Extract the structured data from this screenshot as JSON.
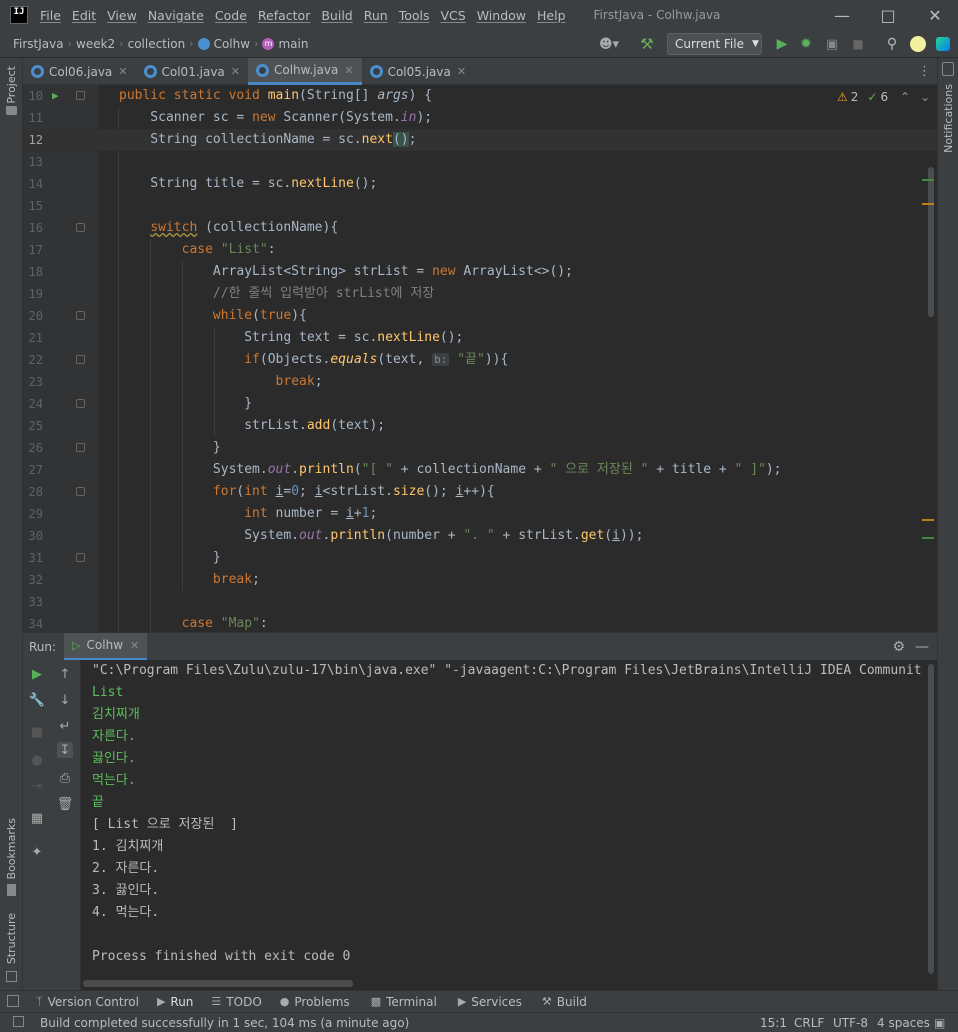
{
  "titlebar": {
    "logo": "IJ",
    "menu": [
      "File",
      "Edit",
      "View",
      "Navigate",
      "Code",
      "Refactor",
      "Build",
      "Run",
      "Tools",
      "VCS",
      "Window",
      "Help"
    ],
    "title": "FirstJava - Colhw.java"
  },
  "navbar": {
    "breadcrumbs": [
      "FirstJava",
      "week2",
      "collection",
      "Colhw",
      "main"
    ],
    "run_config": "Current File"
  },
  "tabs": [
    {
      "label": "Col06.java",
      "active": false
    },
    {
      "label": "Col01.java",
      "active": false
    },
    {
      "label": "Colhw.java",
      "active": true
    },
    {
      "label": "Col05.java",
      "active": false
    }
  ],
  "left_strip": {
    "project": "Project",
    "bookmarks": "Bookmarks",
    "structure": "Structure"
  },
  "right_strip": {
    "notifications": "Notifications"
  },
  "inspections": {
    "warnings": "2",
    "weak": "6"
  },
  "editor": {
    "line_numbers": [
      "10",
      "11",
      "12",
      "13",
      "14",
      "15",
      "16",
      "17",
      "18",
      "19",
      "20",
      "21",
      "22",
      "23",
      "24",
      "25",
      "26",
      "27",
      "28",
      "29",
      "30",
      "31",
      "32",
      "33",
      "34"
    ],
    "current_line": "12",
    "param_hint": "b:"
  },
  "run_panel": {
    "label": "Run:",
    "tab": "Colhw",
    "cmd": "\"C:\\Program Files\\Zulu\\zulu-17\\bin\\java.exe\" \"-javaagent:C:\\Program Files\\JetBrains\\IntelliJ IDEA Communit",
    "inputs": [
      "List",
      "김치찌개",
      "자른다.",
      "끓인다.",
      "먹는다.",
      "끝"
    ],
    "outputs": [
      "[ List 으로 저장된  ]",
      "1. 김치찌개",
      "2. 자른다.",
      "3. 끓인다.",
      "4. 먹는다."
    ],
    "finish": "Process finished with exit code 0"
  },
  "bottom_tabs": [
    "Version Control",
    "Run",
    "TODO",
    "Problems",
    "Terminal",
    "Services",
    "Build"
  ],
  "status": {
    "message": "Build completed successfully in 1 sec, 104 ms (a minute ago)",
    "position": "15:1",
    "line_sep": "CRLF",
    "encoding": "UTF-8",
    "indent": "4 spaces"
  }
}
